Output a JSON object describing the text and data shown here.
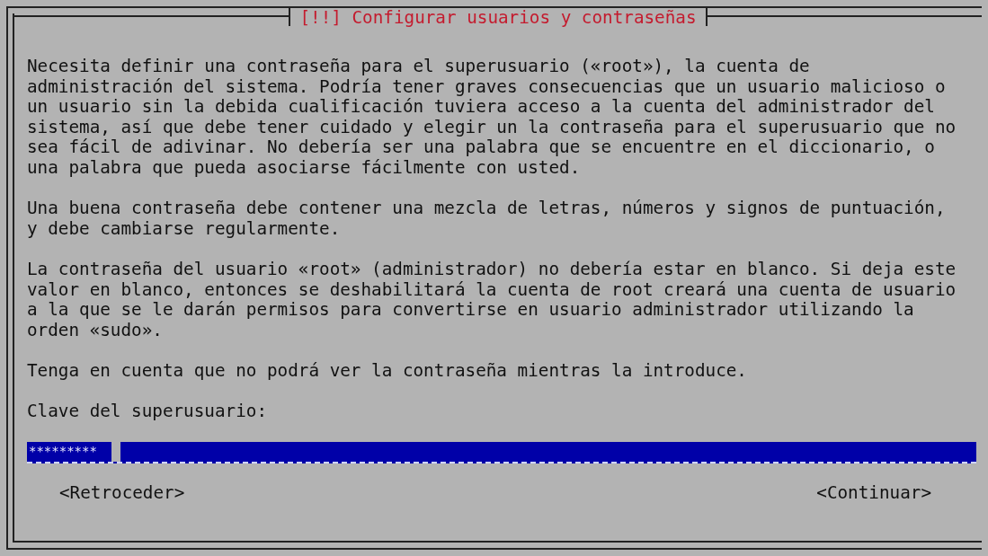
{
  "dialog": {
    "title": "[!!] Configurar usuarios y contraseñas",
    "paragraphs": [
      "Necesita definir una contraseña para el superusuario («root»), la cuenta de\nadministración del sistema. Podría tener graves consecuencias que un usuario malicioso o\nun usuario sin la debida cualificación tuviera acceso a la cuenta del administrador del\nsistema, así que debe tener cuidado y elegir un la contraseña para el superusuario que no\nsea fácil de adivinar. No debería ser una palabra que se encuentre en el diccionario, o\nuna palabra que pueda asociarse fácilmente con usted.",
      "Una buena contraseña debe contener una mezcla de letras, números y signos de puntuación,\ny debe cambiarse regularmente.",
      "La contraseña del usuario «root» (administrador) no debería estar en blanco. Si deja este\nvalor en blanco, entonces se deshabilitará la cuenta de root creará una cuenta de usuario\na la que se le darán permisos para convertirse en usuario administrador utilizando la\norden «sudo».",
      "Tenga en cuenta que no podrá ver la contraseña mientras la introduce."
    ],
    "field_label": "Clave del superusuario:",
    "password_field": {
      "value": "*********"
    },
    "buttons": [
      {
        "label": "<Retroceder>",
        "selected": false
      },
      {
        "label": "<Continuar>",
        "selected": false
      }
    ]
  }
}
